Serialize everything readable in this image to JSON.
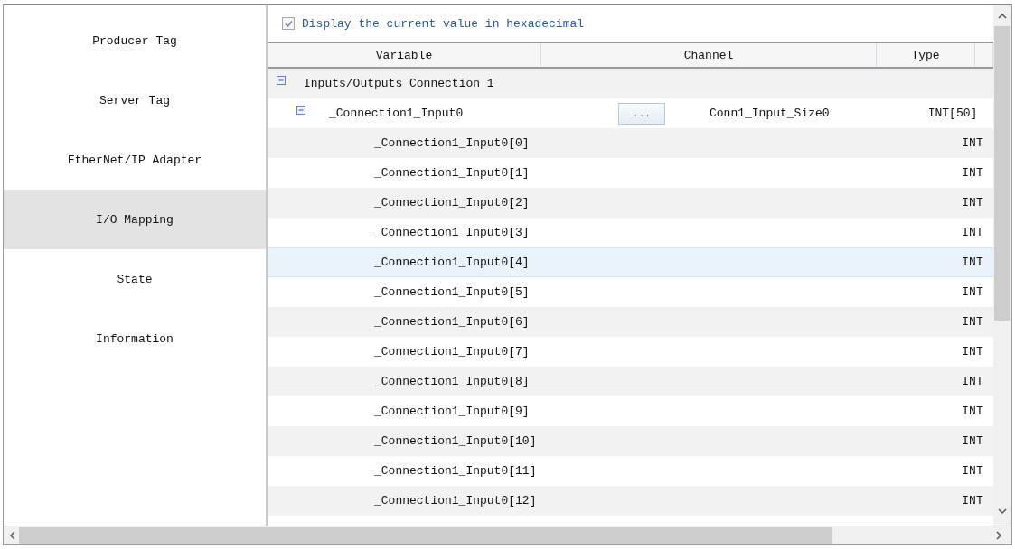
{
  "sidebar": {
    "items": [
      {
        "label": "Producer Tag",
        "selected": false
      },
      {
        "label": "Server Tag",
        "selected": false
      },
      {
        "label": "EtherNet/IP Adapter",
        "selected": false
      },
      {
        "label": "I/O Mapping",
        "selected": true
      },
      {
        "label": "State",
        "selected": false
      },
      {
        "label": "Information",
        "selected": false
      }
    ]
  },
  "option": {
    "label": "Display the current value in hexadecimal",
    "checked": true
  },
  "table": {
    "columns": [
      "Variable",
      "Channel",
      "Type"
    ],
    "rows": [
      {
        "variable": "Inputs/Outputs Connection 1",
        "expanded": true,
        "selected": false,
        "children": [
          {
            "variable": "_Connection1_Input0",
            "button": "...",
            "channel": "Conn1_Input_Size0",
            "type": "INT[50]",
            "expanded": true,
            "selected": false,
            "children": [
              {
                "variable": "_Connection1_Input0[0]",
                "type": "INT",
                "selected": false
              },
              {
                "variable": "_Connection1_Input0[1]",
                "type": "INT",
                "selected": false
              },
              {
                "variable": "_Connection1_Input0[2]",
                "type": "INT",
                "selected": false
              },
              {
                "variable": "_Connection1_Input0[3]",
                "type": "INT",
                "selected": false
              },
              {
                "variable": "_Connection1_Input0[4]",
                "type": "INT",
                "selected": true
              },
              {
                "variable": "_Connection1_Input0[5]",
                "type": "INT",
                "selected": false
              },
              {
                "variable": "_Connection1_Input0[6]",
                "type": "INT",
                "selected": false
              },
              {
                "variable": "_Connection1_Input0[7]",
                "type": "INT",
                "selected": false
              },
              {
                "variable": "_Connection1_Input0[8]",
                "type": "INT",
                "selected": false
              },
              {
                "variable": "_Connection1_Input0[9]",
                "type": "INT",
                "selected": false
              },
              {
                "variable": "_Connection1_Input0[10]",
                "type": "INT",
                "selected": false
              },
              {
                "variable": "_Connection1_Input0[11]",
                "type": "INT",
                "selected": false
              },
              {
                "variable": "_Connection1_Input0[12]",
                "type": "INT",
                "selected": false
              }
            ]
          }
        ]
      }
    ]
  }
}
